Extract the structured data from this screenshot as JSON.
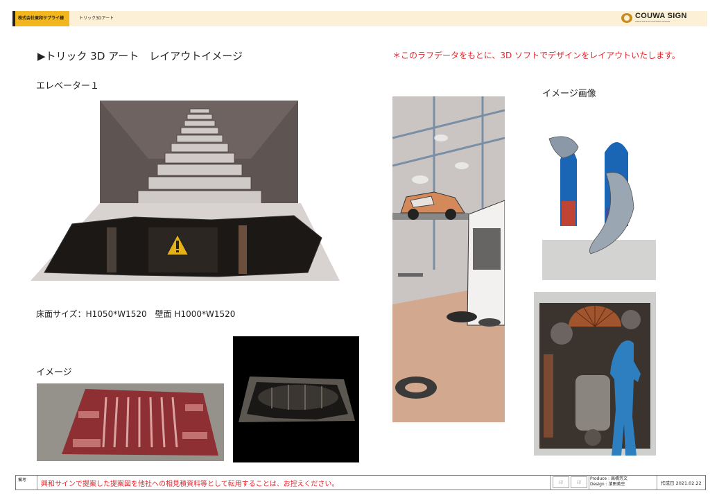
{
  "header": {
    "client": "株式会社東和サプライ様",
    "project": "トリック3Dアート",
    "logo": "COUWA SIGN",
    "logo_sub": "CREATIVE EYE-CATCHING DESIGN"
  },
  "title": "▶トリック 3D アート　レイアウトイメージ",
  "note": "＊このラフデータをもとに、3D ソフトでデザインをレイアウトいたします。",
  "section_elevator": "エレベーター１",
  "section_image_ref": "イメージ画像",
  "size": "床面サイズ：H1050*W1520　壁面 H1000*W1520",
  "section_image": "イメージ",
  "footer": {
    "label": "備考",
    "note": "興和サインで提案した提案図を他社への相見積資料等として転用することは、お控えください。",
    "stamp1": "印",
    "stamp2": "印",
    "produce": "Produce : 高橋芳文",
    "design": "Design : 濱田美空",
    "date": "作成日 2021.02.22"
  }
}
